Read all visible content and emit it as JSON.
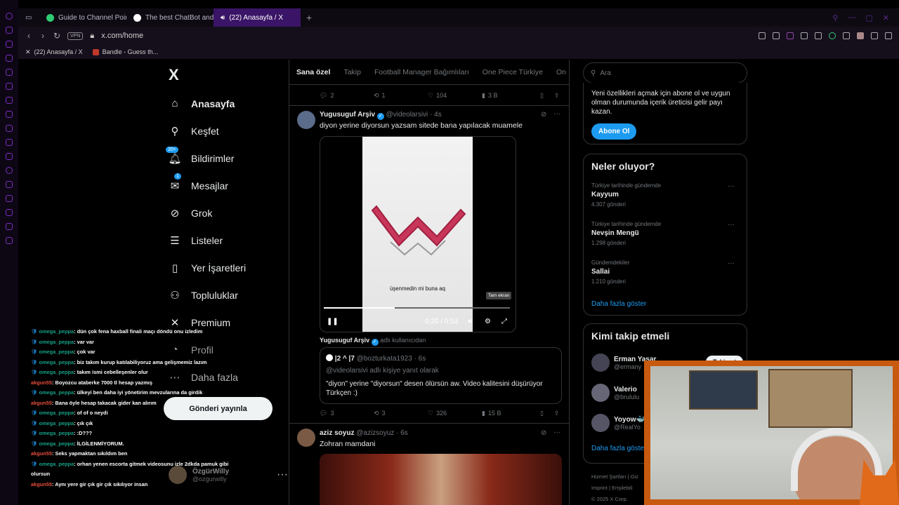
{
  "browser": {
    "tabs": [
      {
        "label": "Guide to Channel Points",
        "fav_color": "#2ecc71",
        "active": false
      },
      {
        "label": "The best ChatBot and Web",
        "fav_color": "#ffffff",
        "active": false
      },
      {
        "label": "(22) Anasayfa / X",
        "fav_color": "#ffffff",
        "active": true
      }
    ],
    "new_tab": "+",
    "vpn": "VPN",
    "url": "x.com/home",
    "bookmarks": [
      "(22) Anasayfa / X",
      "Bandle - Guess th..."
    ]
  },
  "x_nav": {
    "logo": "X",
    "items": [
      {
        "label": "Anasayfa",
        "icon": "home-icon",
        "glyph": "⌂",
        "bold": true
      },
      {
        "label": "Keşfet",
        "icon": "search-icon",
        "glyph": "⚲"
      },
      {
        "label": "Bildirimler",
        "icon": "bell-icon",
        "glyph": "🔔︎",
        "badge": "20+"
      },
      {
        "label": "Mesajlar",
        "icon": "mail-icon",
        "glyph": "✉",
        "badge": "1"
      },
      {
        "label": "Grok",
        "icon": "grok-icon",
        "glyph": "⊘"
      },
      {
        "label": "Listeler",
        "icon": "list-icon",
        "glyph": "☰"
      },
      {
        "label": "Yer İşaretleri",
        "icon": "bookmark-icon",
        "glyph": "▯"
      },
      {
        "label": "Topluluklar",
        "icon": "communities-icon",
        "glyph": "⚇"
      },
      {
        "label": "Premium",
        "icon": "x-premium-icon",
        "glyph": "✕"
      },
      {
        "label": "Profil",
        "icon": "profile-icon",
        "glyph": "◔"
      },
      {
        "label": "Daha fazla",
        "icon": "more-icon",
        "glyph": "⋯"
      }
    ],
    "post_button": "Gönderi yayınla",
    "profile": {
      "name": "ÖzgürWilly",
      "handle": "@ozgurwilly",
      "more": "···"
    }
  },
  "chat": [
    {
      "user": "omega_peppa",
      "color": "#16a085",
      "text": "dün çok fena haxball finali maçı döndü onu izledim"
    },
    {
      "user": "omega_peppa",
      "color": "#16a085",
      "text": "var var"
    },
    {
      "user": "omega_peppa",
      "color": "#16a085",
      "text": "çok var"
    },
    {
      "user": "omega_peppa",
      "color": "#16a085",
      "text": "biz takım kurup katılabiliyoruz ama gelişmemiz lazım"
    },
    {
      "user": "omega_peppa",
      "color": "#16a085",
      "text": "takım ismi cebelleşenler olur"
    },
    {
      "user": "akgun55",
      "color": "#e74c3c",
      "text": "Boyozcu ataberke 7000 tl hesap yazmış"
    },
    {
      "user": "omega_peppa",
      "color": "#16a085",
      "text": "ülkeyi ben daha iyi yönetirim mevzularına da girdik"
    },
    {
      "user": "akgun55",
      "color": "#e74c3c",
      "text": "Bana öyle hesap takacak gider kan alırım"
    },
    {
      "user": "omega_peppa",
      "color": "#16a085",
      "text": "of of o neydi"
    },
    {
      "user": "omega_peppa",
      "color": "#16a085",
      "text": "çık çık"
    },
    {
      "user": "omega_peppa",
      "color": "#16a085",
      "text": ":D???"
    },
    {
      "user": "omega_peppa",
      "color": "#16a085",
      "text": "İLGİLENMİYORUM."
    },
    {
      "user": "akgun55",
      "color": "#e74c3c",
      "text": "Seks yapmaktan sıkıldım ben"
    },
    {
      "user": "omega_peppa",
      "color": "#16a085",
      "text": "orhan yenen escorta gitmek videosunu izle 2dkda pamuk gibi"
    },
    {
      "user": "",
      "color": "#ffffff",
      "text": "olursun"
    },
    {
      "user": "akgun55",
      "color": "#e74c3c",
      "text": "Aynı yere gir çık gir çık sıkılıyor insan"
    }
  ],
  "timeline": {
    "tabs": [
      "Sana özel",
      "Takip",
      "Football Manager Bağımlıları",
      "One Piece Türkiye",
      "On"
    ],
    "prev_actions": {
      "replies": "2",
      "reposts": "1",
      "likes": "104",
      "views": "3 B"
    },
    "tweet1": {
      "name": "Yugusuguf Arşiv",
      "handle": "@videolarsivi",
      "time": "· 4s",
      "text": "diyon yerine diyorsun yazsam sitede bana yapılacak muamele",
      "video": {
        "caption": "üşenmedin mi buna aq",
        "tooltip": "Tam ekran",
        "time": "0:20 / 0:53",
        "progress": 0.38
      },
      "replying_user": "Yugusuguf Arşiv",
      "replying_label": "adlı kullanıcıdan",
      "quote": {
        "name": "|2 ^ |7",
        "handle": "@bozturkata1923",
        "time": "· 6s",
        "reply_to": "@videolarsivi adlı kişiye yanıt olarak",
        "text": "\"diyon\" yerine \"diyorsun\" desen ölürsün aw. Video kalitesini düşürüyor Türkçen :)"
      },
      "actions": {
        "replies": "3",
        "reposts": "3",
        "likes": "326",
        "views": "15 B"
      }
    },
    "tweet2": {
      "name": "aziz soyuz",
      "handle": "@azizsoyuz",
      "time": "· 6s",
      "text": "Zohran mamdani"
    }
  },
  "right": {
    "search_placeholder": "Ara",
    "premium": {
      "text": "Yeni özellikleri açmak için abone ol ve uygun olman durumunda içerik üreticisi gelir payı kazan.",
      "button": "Abone Ol"
    },
    "trends": {
      "title": "Neler oluyor?",
      "items": [
        {
          "context": "Türkiye tarihinde gündemde",
          "topic": "Kayyum",
          "count": "4.307 gönderi"
        },
        {
          "context": "Türkiye tarihinde gündemde",
          "topic": "Nevşin Mengü",
          "count": "1.298 gönderi"
        },
        {
          "context": "Gündemdekiler",
          "topic": "Sallai",
          "count": "1.210 gönderi"
        }
      ],
      "show_more": "Daha fazla göster"
    },
    "who_to_follow": {
      "title": "Kimi takip etmeli",
      "items": [
        {
          "name": "Erman Yaşar",
          "handle": "@ermany",
          "color": "#444"
        },
        {
          "name": "Valerio",
          "handle": "@brululu",
          "color": "#667"
        },
        {
          "name": "Yoyow🐳",
          "handle": "@RealYo",
          "color": "#556"
        }
      ],
      "follow": "Takip et",
      "show_more": "Daha fazla göste"
    },
    "footer": {
      "line1": "Hizmet Şartları  |  Giz",
      "line2": "Imprint  |  Erişilebili",
      "line3": "© 2025 X Corp."
    }
  }
}
